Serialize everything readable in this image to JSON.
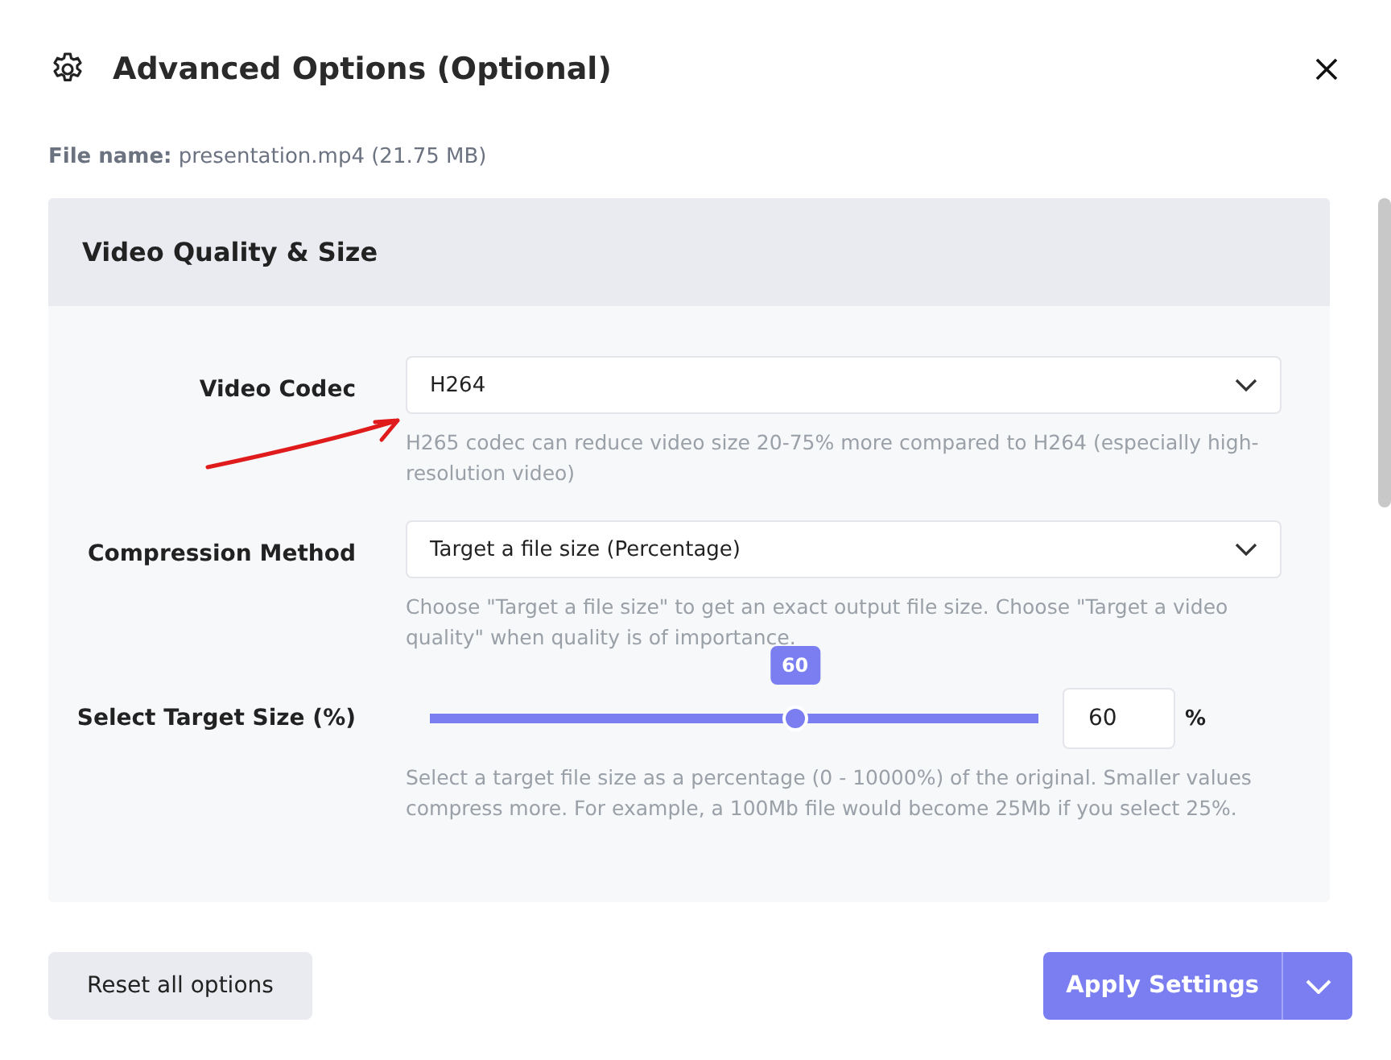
{
  "dialog": {
    "title": "Advanced Options (Optional)",
    "file_label": "File name:",
    "file_value": "presentation.mp4 (21.75 MB)"
  },
  "section": {
    "title": "Video Quality & Size",
    "fields": [
      {
        "kind": "select",
        "label": "Video Codec",
        "value": "H264",
        "help": "H265 codec can reduce video size 20-75% more compared to H264 (especially high-resolution video)",
        "annotated": true
      },
      {
        "kind": "select",
        "label": "Compression Method",
        "value": "Target a file size (Percentage)",
        "help": "Choose \"Target a file size\" to get an exact output file size. Choose \"Target a video quality\" when quality is of importance.",
        "annotated": false
      },
      {
        "kind": "slider",
        "label": "Select Target Size (%)",
        "bubble": "60",
        "level": 0.6,
        "value": "60",
        "unit": "%",
        "help": "Select a target file size as a percentage (0 - 10000%) of the original. Smaller values compress more. For example, a 100Mb file would become 25Mb if you select 25%.",
        "annotated": false
      }
    ]
  },
  "footer": {
    "reset": "Reset all options",
    "apply": "Apply Settings"
  }
}
